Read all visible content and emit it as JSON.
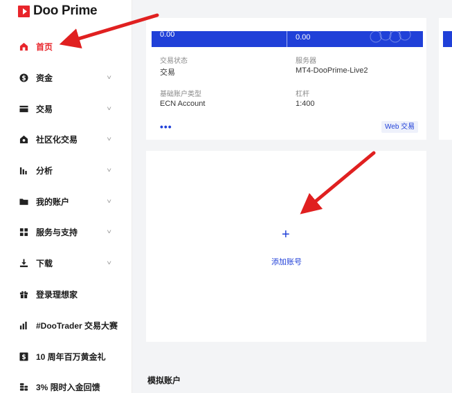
{
  "brand": {
    "name": "Doo Prime",
    "color": "#e8252b"
  },
  "sidebar": {
    "items": [
      {
        "label": "首页",
        "icon": "home-icon",
        "active": true,
        "has_chevron": false
      },
      {
        "label": "资金",
        "icon": "dollar-icon",
        "active": false,
        "has_chevron": true
      },
      {
        "label": "交易",
        "icon": "card-icon",
        "active": false,
        "has_chevron": true
      },
      {
        "label": "社区化交易",
        "icon": "community-icon",
        "active": false,
        "has_chevron": true
      },
      {
        "label": "分析",
        "icon": "bar-chart-icon",
        "active": false,
        "has_chevron": true
      },
      {
        "label": "我的账户",
        "icon": "folder-icon",
        "active": false,
        "has_chevron": true
      },
      {
        "label": "服务与支持",
        "icon": "grid-icon",
        "active": false,
        "has_chevron": true
      },
      {
        "label": "下载",
        "icon": "download-icon",
        "active": false,
        "has_chevron": true
      },
      {
        "label": "登录理想家",
        "icon": "gift-icon",
        "active": false,
        "has_chevron": false
      },
      {
        "label": "#DooTrader 交易大赛",
        "icon": "trophy-chart-icon",
        "active": false,
        "has_chevron": false
      },
      {
        "label": "10 周年百万黄金礼",
        "icon": "dollar-box-icon",
        "active": false,
        "has_chevron": false
      },
      {
        "label": "3% 限时入金回馈",
        "icon": "coins-icon",
        "active": false,
        "has_chevron": false
      }
    ],
    "chevron": "˅"
  },
  "account_card": {
    "balance_left": "0.00",
    "balance_right": "0.00",
    "trade_status_label": "交易状态",
    "trade_status_value": "交易",
    "server_label": "服务器",
    "server_value": "MT4-DooPrime-Live2",
    "account_type_label": "基础账户类型",
    "account_type_value": "ECN Account",
    "leverage_label": "杠杆",
    "leverage_value": "1:400",
    "more_label": "•••",
    "web_trade_button": "Web 交易",
    "accent": "#2040d8"
  },
  "add_account": {
    "plus": "+",
    "label": "添加账号"
  },
  "demo_section": {
    "title": "模拟账户"
  },
  "annotation_color": "#e02020"
}
